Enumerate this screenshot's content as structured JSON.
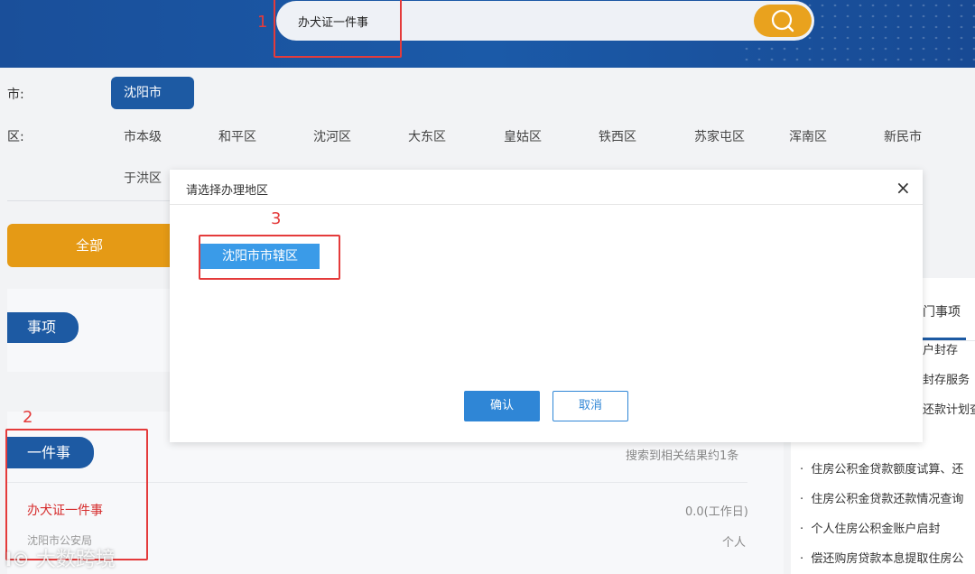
{
  "search": {
    "query": "办犬证一件事"
  },
  "annotations": [
    "1",
    "2",
    "3"
  ],
  "filter": {
    "city_label": "市:",
    "district_label": "区:",
    "city_selected": "沈阳市",
    "districts": [
      "市本级",
      "和平区",
      "沈河区",
      "大东区",
      "皇姑区",
      "铁西区",
      "苏家屯区",
      "浑南区",
      "新民市",
      "于洪区"
    ]
  },
  "tabs": {
    "all": "全部",
    "items": "事项",
    "one_thing": "一件事"
  },
  "result": {
    "count_text": "搜索到相关结果约1条",
    "title": "办犬证一件事",
    "dept": "沈阳市公安局",
    "duration": "0.0(工作日)",
    "target": "个人"
  },
  "sidebar": {
    "header": "门事项",
    "items": [
      "户封存",
      "封存服务",
      "还款计划查询"
    ],
    "items2": [
      "住房公积金贷款额度试算、还",
      "住房公积金贷款还款情况查询",
      "个人住房公积金账户启封",
      "偿还购房贷款本息提取住房公"
    ]
  },
  "modal": {
    "title": "请选择办理地区",
    "close": "×",
    "region_option": "沈阳市市辖区",
    "confirm": "确认",
    "cancel": "取消"
  },
  "watermark": "大数跨境",
  "colors": {
    "header": "#1b5aa8",
    "accent_orange": "#e59a15",
    "primary_blue": "#1d5aa3",
    "annotation_red": "#e43b3b"
  }
}
